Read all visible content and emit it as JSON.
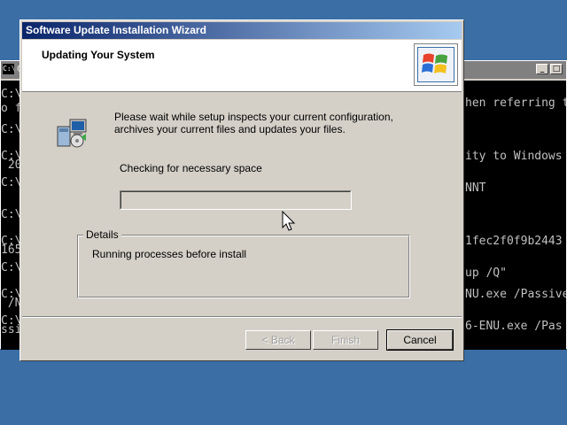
{
  "console": {
    "title_icon": "C:\\",
    "title": "C",
    "lines_left": [
      "C:\\",
      "o f",
      "C:\\",
      "C:\\",
      " 20",
      "C:\\",
      "C:\\",
      "C:\\",
      "165",
      "C:\\",
      "C:\\",
      " /N",
      "C:\\",
      "ssiv"
    ],
    "lines_right": [
      "hen referring t",
      "ity to Windows",
      "NNT",
      "1fec2f0f9b2443",
      "up /Q\"",
      "NU.exe /Passive",
      "6-ENU.exe /Pas"
    ],
    "icons": {
      "minimize": "minimize-icon",
      "maximize": "maximize-icon",
      "close": "close-icon"
    }
  },
  "wizard": {
    "title": "Software Update Installation Wizard",
    "header_title": "Updating Your System",
    "intro": "Please wait while setup inspects your current configuration, archives your current files and updates your files.",
    "status": "Checking for necessary space",
    "progress_value": 0,
    "details_label": "Details",
    "details_text": "Running processes before install",
    "buttons": {
      "back": "< Back",
      "finish": "Finish",
      "cancel": "Cancel"
    }
  }
}
